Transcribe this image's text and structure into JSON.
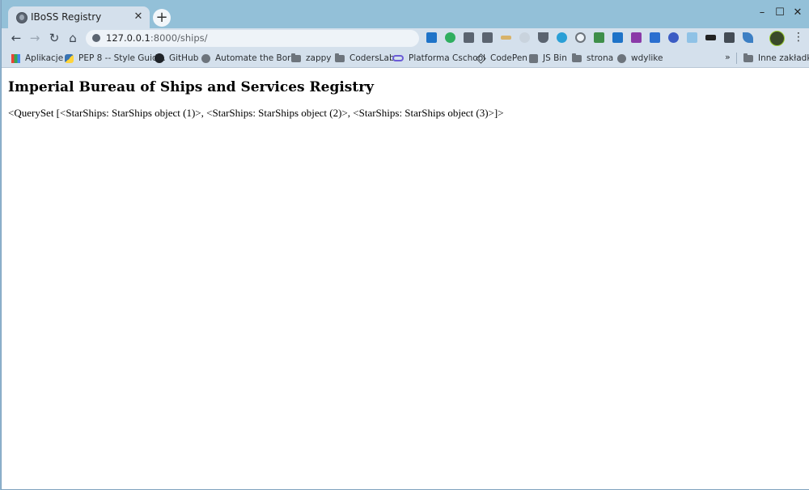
{
  "browser": {
    "tab": {
      "title": "IBoSS Registry",
      "close_glyph": "✕",
      "favicon": "globe-icon"
    },
    "new_tab_glyph": "+",
    "window_controls": {
      "minimize": "–",
      "maximize": "☐",
      "close": "✕"
    },
    "nav": {
      "back": "←",
      "forward": "→",
      "reload": "↻",
      "home": "⌂"
    },
    "address": {
      "host": "127.0.0.1",
      "path": ":8000/ships/"
    },
    "menu_glyph": "⋮",
    "bookmarks": [
      {
        "label": "Aplikacje",
        "icon": "apps-grid-icon"
      },
      {
        "label": "PEP 8 -- Style Guid...",
        "icon": "python-icon"
      },
      {
        "label": "GitHub",
        "icon": "github-icon"
      },
      {
        "label": "Automate the Bori...",
        "icon": "globe-icon"
      },
      {
        "label": "zappy",
        "icon": "folder-icon"
      },
      {
        "label": "CodersLab",
        "icon": "folder-icon"
      },
      {
        "label": "Platforma Cschool",
        "icon": "cschool-icon"
      },
      {
        "label": "CodePen",
        "icon": "codepen-icon"
      },
      {
        "label": "JS Bin",
        "icon": "jsbin-icon"
      },
      {
        "label": "strona",
        "icon": "folder-icon"
      },
      {
        "label": "wdylike",
        "icon": "globe-icon"
      }
    ],
    "bookmarks_overflow": "»",
    "other_bookmarks": {
      "label": "Inne zakładki",
      "icon": "folder-icon"
    }
  },
  "page": {
    "heading": "Imperial Bureau of Ships and Services Registry",
    "queryset_text": "<QuerySet [<StarShips: StarShips object (1)>, <StarShips: StarShips object (2)>, <StarShips: StarShips object (3)>]>"
  }
}
